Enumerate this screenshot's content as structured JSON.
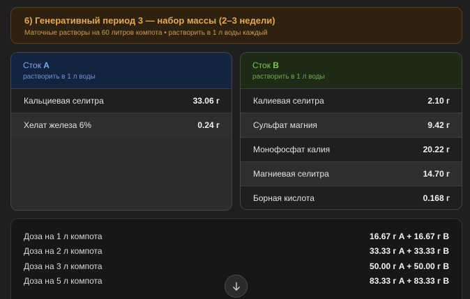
{
  "period": {
    "title": "6) Генеративный период 3 — набор массы (2–3 недели)",
    "subtitle": "Маточные растворы на 60 литров компота • растворить в 1 л воды каждый"
  },
  "stock_a": {
    "title_prefix": "Сток ",
    "title_letter": "A",
    "note": "растворить в 1 л воды",
    "items": [
      {
        "name": "Кальциевая селитра",
        "value": "33.06 г"
      },
      {
        "name": "Хелат железа 6%",
        "value": "0.24 г"
      }
    ]
  },
  "stock_b": {
    "title_prefix": "Сток ",
    "title_letter": "B",
    "note": "растворить в 1 л воды",
    "items": [
      {
        "name": "Калиевая селитра",
        "value": "2.10 г"
      },
      {
        "name": "Сульфат магния",
        "value": "9.42 г"
      },
      {
        "name": "Монофосфат калия",
        "value": "20.22 г"
      },
      {
        "name": "Магниевая селитра",
        "value": "14.70 г"
      },
      {
        "name": "Борная кислота",
        "value": "0.168 г"
      }
    ]
  },
  "doses": [
    {
      "label": "Доза на 1 л компота",
      "value": "16.67 г A + 16.67 г B"
    },
    {
      "label": "Доза на 2 л компота",
      "value": "33.33 г A + 33.33 г B"
    },
    {
      "label": "Доза на 3 л компота",
      "value": "50.00 г A + 50.00 г B"
    },
    {
      "label": "Доза на 5 л компота",
      "value": "83.33 г A + 83.33 г B"
    }
  ],
  "icons": {
    "scroll": "arrow-down-icon"
  },
  "colors": {
    "accent_orange": "#e3a85a",
    "stock_a_blue": "#7fa9ea",
    "stock_b_green": "#83c15e"
  }
}
